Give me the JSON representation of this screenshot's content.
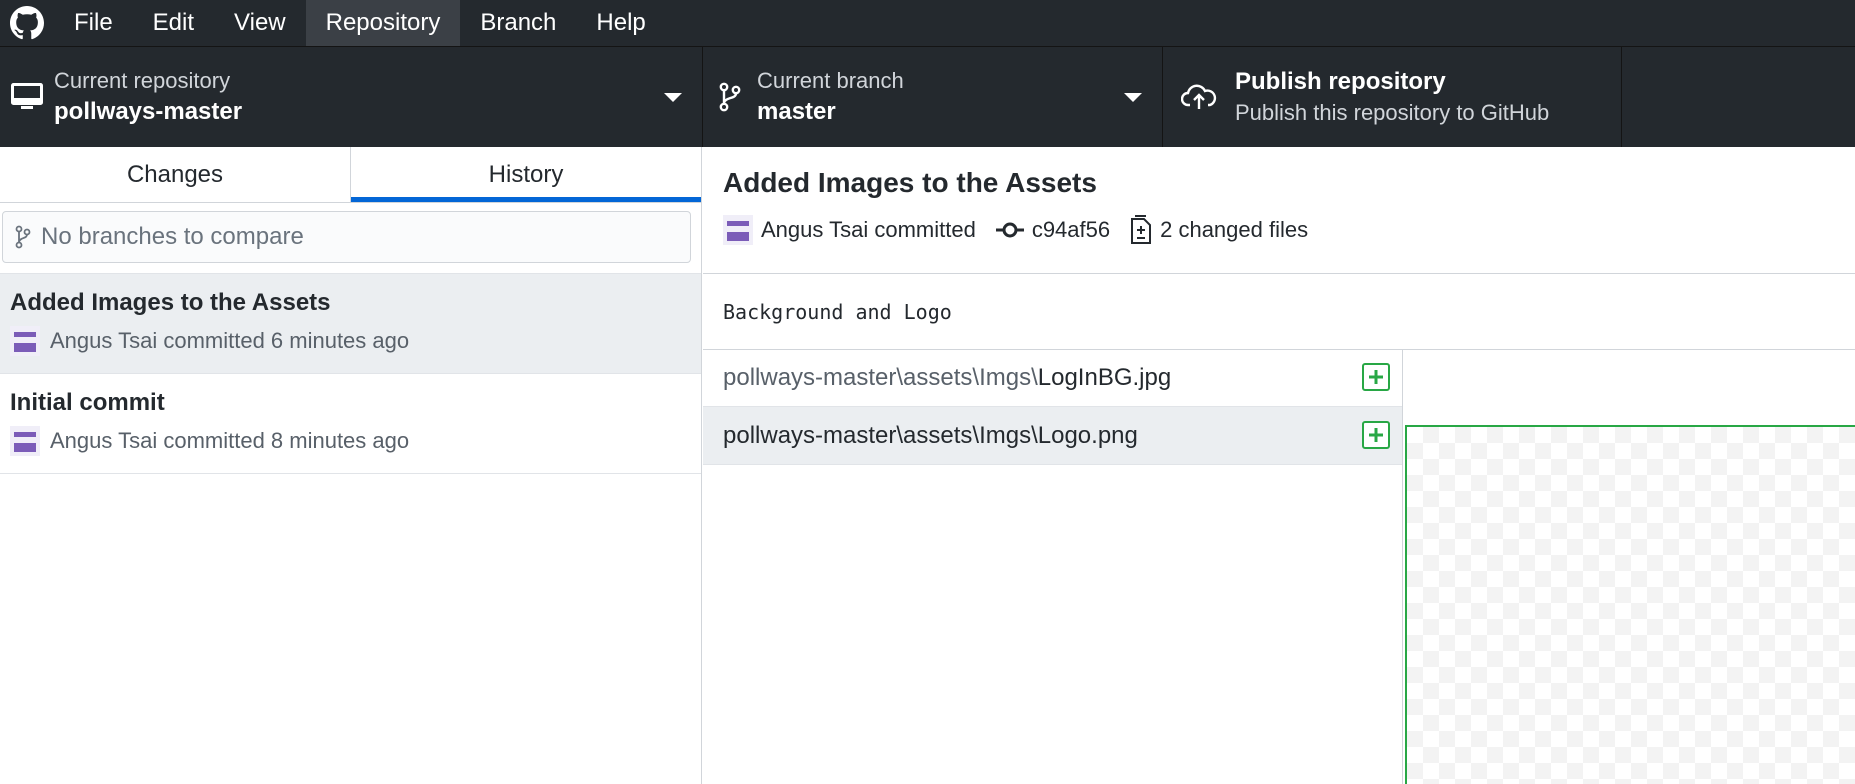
{
  "menu": {
    "items": [
      "File",
      "Edit",
      "View",
      "Repository",
      "Branch",
      "Help"
    ],
    "active": "Repository"
  },
  "toolbar": {
    "repo_label": "Current repository",
    "repo_name": "pollways-master",
    "branch_label": "Current branch",
    "branch_name": "master",
    "publish_title": "Publish repository",
    "publish_desc": "Publish this repository to GitHub"
  },
  "sidebar": {
    "tabs": [
      "Changes",
      "History"
    ],
    "selected_tab": "History",
    "compare_placeholder": "No branches to compare",
    "commits": [
      {
        "title": "Added Images to the Assets",
        "meta": "Angus Tsai committed 6 minutes ago"
      },
      {
        "title": "Initial commit",
        "meta": "Angus Tsai committed 8 minutes ago"
      }
    ]
  },
  "commit": {
    "title": "Added Images to the Assets",
    "author": "Angus Tsai committed",
    "sha": "c94af56",
    "changed": "2 changed files",
    "body": "Background and Logo"
  },
  "files": [
    {
      "dir": "pollways-master\\assets\\Imgs\\",
      "name": "LogInBG.jpg"
    },
    {
      "dir": "pollways-master\\assets\\Imgs\\",
      "name": "Logo.png"
    }
  ],
  "colors": {
    "accent": "#0366d6",
    "added": "#28a745",
    "toolbar_bg": "#24292e"
  }
}
